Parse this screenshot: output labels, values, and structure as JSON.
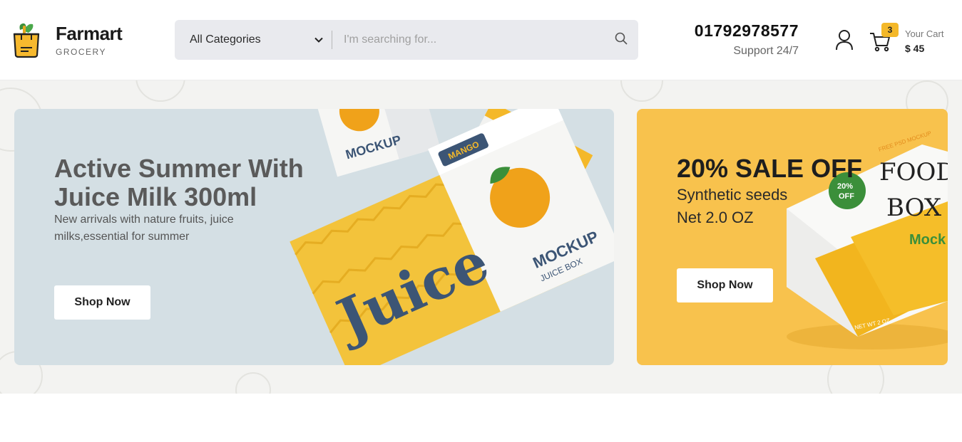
{
  "brand": {
    "name": "Farmart",
    "tagline": "GROCERY"
  },
  "search": {
    "category_label": "All Categories",
    "placeholder": "I'm searching for..."
  },
  "contact": {
    "phone": "01792978577",
    "support": "Support 24/7"
  },
  "cart": {
    "count": "3",
    "label": "Your Cart",
    "total": "$ 45"
  },
  "icons": {
    "logo": "grocery-bag-icon",
    "dropdown": "chevron-down-icon",
    "search": "search-icon",
    "user": "user-icon",
    "cart": "cart-icon"
  },
  "hero_main": {
    "title": "Active Summer With Juice Milk 300ml",
    "description": "New arrivals with nature fruits, juice milks,essential for summer",
    "button": "Shop Now",
    "art_text": {
      "mockup": "MOCKUP",
      "juice_box": "JUICE BOX",
      "mango": "MANGO",
      "juice": "Juice"
    }
  },
  "hero_side": {
    "title": "20% SALE OFF",
    "line1": "Synthetic seeds",
    "line2": "Net 2.0 OZ",
    "button": "Shop Now",
    "art_text": {
      "food": "FOOD",
      "box": "BOX",
      "mockup": "Mock",
      "badge_top": "20%",
      "badge_bottom": "OFF",
      "ribbon": "FREE PSD MOCKUP",
      "weight": "NET WT 2 OZ"
    }
  },
  "colors": {
    "accent": "#f4b829",
    "main_banner_bg": "#d4dfe4",
    "side_banner_bg": "#f8c24d",
    "navy": "#3c5575"
  }
}
